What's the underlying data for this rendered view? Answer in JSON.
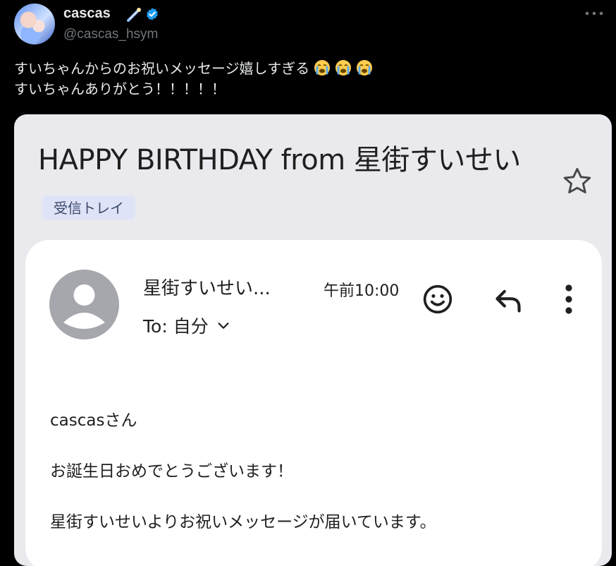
{
  "tweet": {
    "display_name": "cascas",
    "handle": "@cascas_hsym",
    "line1": "すいちゃんからのお祝いメッセージ嬉しすぎる",
    "line2": "すいちゃんありがとう！！！！！",
    "emoji_count_note": "loudly-crying-face"
  },
  "email": {
    "subject": "HAPPY BIRTHDAY from 星街すいせい",
    "label": "受信トレイ",
    "sender": "星街すいせい...",
    "time": "午前10:00",
    "to": "To: 自分",
    "body": [
      "cascasさん",
      "お誕生日おめでとうございます！",
      "星街すいせいよりお祝いメッセージが届いています。"
    ]
  },
  "colors": {
    "background": "#000000",
    "card": "#e9e9ee",
    "message": "#ffffff",
    "verified": "#1d9bf0",
    "label_chip": "#dfe3f7",
    "avatar_placeholder": "#a6a6ad"
  }
}
